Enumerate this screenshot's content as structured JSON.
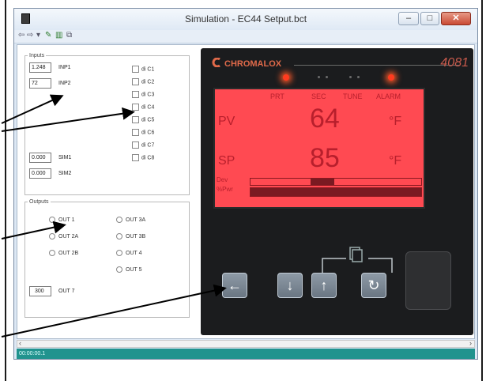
{
  "window": {
    "title": "Simulation - EC44 Setput.bct",
    "controls": {
      "minimize": "–",
      "maximize": "□",
      "close": "✕"
    }
  },
  "toolbar": {
    "items": [
      {
        "icon": "back-arrow-icon",
        "glyph": "⇦"
      },
      {
        "icon": "forward-arrow-icon",
        "glyph": "⇨"
      },
      {
        "icon": "dropdown-icon",
        "glyph": "▾"
      },
      {
        "icon": "edit-icon",
        "glyph": "✎"
      },
      {
        "icon": "chart-icon",
        "glyph": "▥"
      },
      {
        "icon": "copy-icon",
        "glyph": "⧉"
      }
    ]
  },
  "inputs": {
    "legend": "Inputs",
    "inp1": {
      "value": "1.248",
      "label": "INP1"
    },
    "inp2": {
      "value": "72",
      "label": "INP2"
    },
    "sim1": {
      "value": "0.000",
      "label": "SIM1"
    },
    "sim2": {
      "value": "0.000",
      "label": "SIM2"
    },
    "digital": [
      "di C1",
      "di C2",
      "di C3",
      "di C4",
      "di C5",
      "di C6",
      "di C7",
      "di C8"
    ]
  },
  "outputs": {
    "legend": "Outputs",
    "left": [
      "OUT 1",
      "OUT 2A",
      "OUT 2B"
    ],
    "right": [
      "OUT 3A",
      "OUT 3B",
      "OUT 4",
      "OUT 5"
    ],
    "out7": {
      "value": "300",
      "label": "OUT 7"
    }
  },
  "device": {
    "brand": "CHROMALOX",
    "model": "4081",
    "status_labels": [
      "PRT",
      "SEC",
      "TUNE",
      "ALARM"
    ],
    "pv_label": "PV",
    "pv_value": "64",
    "pv_unit": "°F",
    "sp_label": "SP",
    "sp_value": "85",
    "sp_unit": "°F",
    "dev_label": "Dev",
    "pwr_label": "%Pwr",
    "deviation_fraction": 0.35,
    "power_fraction": 1.0,
    "keys": [
      {
        "name": "left-arrow-key",
        "glyph": "←"
      },
      {
        "name": "down-arrow-key",
        "glyph": "↓"
      },
      {
        "name": "up-arrow-key",
        "glyph": "↑"
      },
      {
        "name": "cycle-key",
        "glyph": "↻"
      }
    ]
  },
  "statusbar": {
    "text": "00:00:00.1"
  },
  "colors": {
    "lcd": "#ff4a52",
    "lcd_text": "#b81f2c",
    "status_bar": "#21938e",
    "led": "#ff3b1f"
  }
}
